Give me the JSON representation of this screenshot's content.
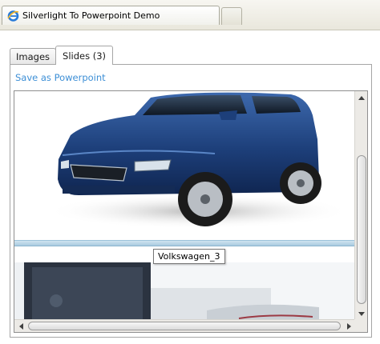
{
  "browser": {
    "tab_title": "Silverlight To Powerpoint Demo",
    "icon": "internet-explorer-icon"
  },
  "tabs": [
    {
      "label": "Images",
      "active": false
    },
    {
      "label": "Slides (3)",
      "active": true
    }
  ],
  "actions": {
    "save_label": "Save as Powerpoint",
    "link_color": "#3d8fd6"
  },
  "slides": [
    {
      "image": "blue-car-photo"
    },
    {
      "image": "volkswagen-photo",
      "tooltip": "Volkswagen_3"
    }
  ],
  "colors": {
    "car_body": "#1d3f7a",
    "selection_bar": "#b9d7ea"
  }
}
